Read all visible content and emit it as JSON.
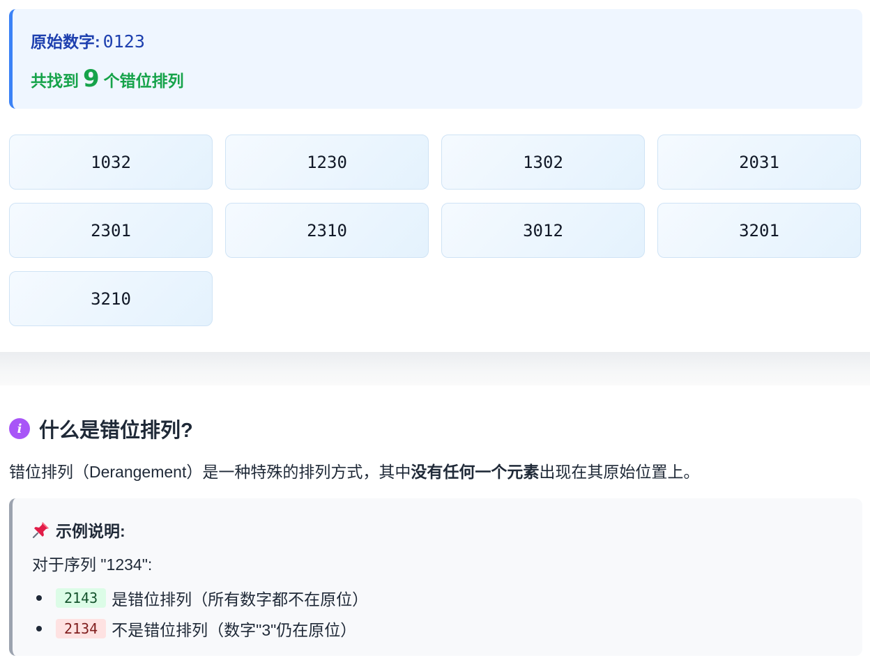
{
  "result": {
    "original_label": "原始数字:",
    "original_value": "0123",
    "count_prefix": "共找到",
    "count_value": "9",
    "count_suffix": "个错位排列"
  },
  "permutations": [
    "1032",
    "1230",
    "1302",
    "2031",
    "2301",
    "2310",
    "3012",
    "3201",
    "3210"
  ],
  "info": {
    "icon": "info-icon",
    "icon_glyph": "i",
    "title": "什么是错位排列?",
    "desc_before": "错位排列（Derangement）是一种特殊的排列方式，其中",
    "desc_bold": "没有任何一个元素",
    "desc_after": "出现在其原始位置上。"
  },
  "example": {
    "icon": "pushpin-icon",
    "title": "示例说明:",
    "intro": "对于序列 \"1234\":",
    "items": [
      {
        "code": "2143",
        "text": "是错位排列（所有数字都不在原位）",
        "status": "good"
      },
      {
        "code": "2134",
        "text": "不是错位排列（数字\"3\"仍在原位）",
        "status": "bad"
      }
    ]
  },
  "colors": {
    "accent_blue": "#3b82f6",
    "success_green": "#16a34a",
    "info_purple": "#a855f7"
  }
}
